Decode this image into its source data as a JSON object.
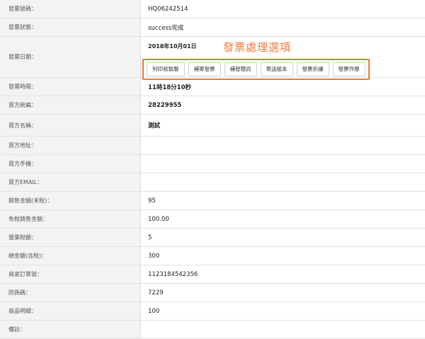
{
  "annotation": "發票處理選項",
  "fields": [
    {
      "label": "發票號碼：",
      "value": "HQ06242514"
    },
    {
      "label": "發票狀態：",
      "value": "success完成"
    },
    {
      "label": "發票日期：",
      "value": "2018年10月01日"
    },
    {
      "label": "發票時間：",
      "value": "11時18分10秒"
    },
    {
      "label": "買方統編：",
      "value": "28229955"
    },
    {
      "label": "買方名稱：",
      "value": "測試"
    },
    {
      "label": "買方地址：",
      "value": ""
    },
    {
      "label": "買方手機：",
      "value": ""
    },
    {
      "label": "買方EMAIL：",
      "value": ""
    },
    {
      "label": "銷售金額(未稅)：",
      "value": "95"
    },
    {
      "label": "免稅銷售金額：",
      "value": "100.00"
    },
    {
      "label": "營業稅額：",
      "value": "5"
    },
    {
      "label": "總金額(含稅)：",
      "value": "300"
    },
    {
      "label": "商家訂單號：",
      "value": "1123184542356"
    },
    {
      "label": "防偽碼：",
      "value": "7229"
    },
    {
      "label": "商品明細：",
      "value": "100"
    },
    {
      "label": "備註：",
      "value": ""
    }
  ],
  "buttons": [
    "列印收執聯",
    "補寄發票",
    "補發簡訊",
    "寄送紙本",
    "發票折讓",
    "發票作廢"
  ]
}
